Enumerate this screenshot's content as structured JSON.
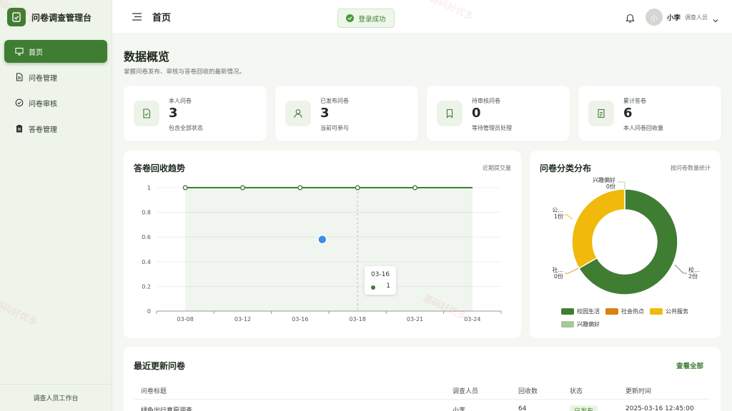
{
  "brand": {
    "title": "问卷调查管理台"
  },
  "sidebar": {
    "items": [
      {
        "label": "首页",
        "active": true
      },
      {
        "label": "问卷管理"
      },
      {
        "label": "问卷审核"
      },
      {
        "label": "答卷管理"
      }
    ],
    "footer": "调查人员工作台"
  },
  "header": {
    "title": "首页",
    "toast": "登录成功",
    "avatar_text": "小",
    "user_name": "小李",
    "user_role": "调查人员"
  },
  "overview": {
    "title": "数据概览",
    "description": "掌握问卷发布、审核与答卷回收的最新情况。"
  },
  "stats": [
    {
      "label": "本人问卷",
      "value": "3",
      "sub": "包含全部状态"
    },
    {
      "label": "已发布问卷",
      "value": "3",
      "sub": "当前可参与"
    },
    {
      "label": "待审核问卷",
      "value": "0",
      "sub": "等待管理员处理"
    },
    {
      "label": "累计答卷",
      "value": "6",
      "sub": "本人问卷回收量"
    }
  ],
  "trend": {
    "title": "答卷回收趋势",
    "note": "近期提交量",
    "tooltip": {
      "date": "03-16",
      "value": "1"
    }
  },
  "distribution": {
    "title": "问卷分类分布",
    "note": "按问卷数量统计",
    "callouts": [
      {
        "name": "兴趣偏好",
        "count": "0份"
      },
      {
        "name": "公...",
        "count": "1份"
      },
      {
        "name": "社...",
        "count": "0份"
      },
      {
        "name": "校...",
        "count": "2份"
      }
    ]
  },
  "recent": {
    "title": "最近更新问卷",
    "view_all": "查看全部",
    "columns": [
      "问卷标题",
      "调查人员",
      "回收数",
      "状态",
      "更新时间"
    ],
    "row": {
      "title": "绿色出行意愿调查",
      "owner": "小李",
      "count": "64",
      "status": "已发布",
      "time": "2025-03-16 12:45:00"
    }
  },
  "watermark": "源码好优多",
  "colors": {
    "primary": "#3f7d33",
    "orange": "#d9820f",
    "yellow": "#f0b90b",
    "light": "#a8c79b",
    "point": "#3a8ee6"
  },
  "chart_data": [
    {
      "type": "area",
      "title": "答卷回收趋势",
      "x": [
        "03-08",
        "03-12",
        "03-16",
        "03-18",
        "03-21",
        "03-24"
      ],
      "series": [
        {
          "values": [
            1,
            1,
            1,
            1,
            1,
            1
          ]
        }
      ],
      "yticks": [
        0,
        0.2,
        0.4,
        0.6,
        0.8,
        1
      ],
      "ylim": [
        0,
        1
      ],
      "grid": true
    },
    {
      "type": "pie",
      "title": "问卷分类分布",
      "categories": [
        "校园生活",
        "社会热点",
        "公共服务",
        "兴趣偏好"
      ],
      "values": [
        2,
        0,
        1,
        0
      ],
      "colors": [
        "#3f7d33",
        "#d9820f",
        "#f0b90b",
        "#a8c79b"
      ],
      "legend": "bottom"
    }
  ]
}
